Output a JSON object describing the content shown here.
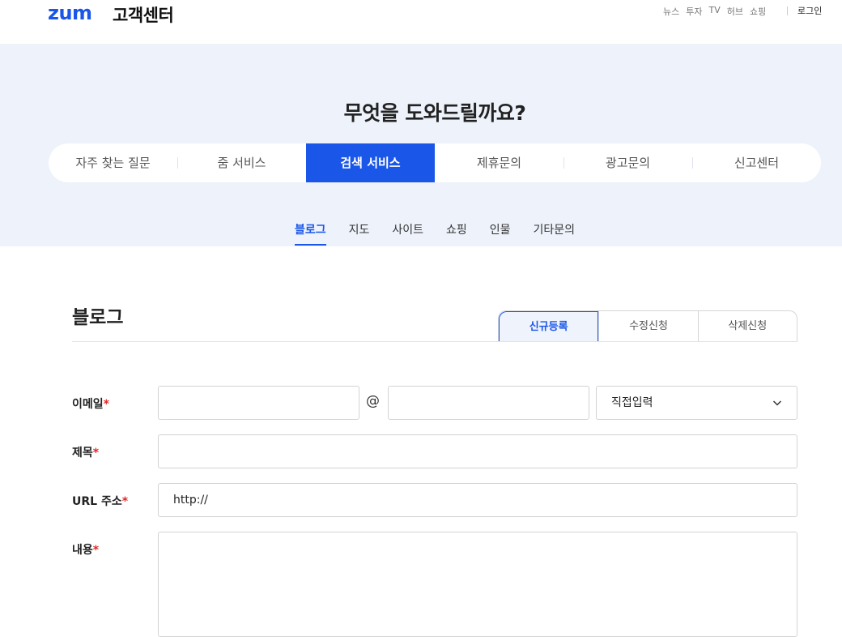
{
  "header": {
    "logo": "zum",
    "site_title": "고객센터",
    "util_links": [
      "뉴스",
      "투자",
      "TV",
      "허브",
      "쇼핑"
    ],
    "login": "로그인"
  },
  "hero": {
    "title": "무엇을 도와드릴까요?",
    "categories": [
      "자주 찾는 질문",
      "줌 서비스",
      "검색 서비스",
      "제휴문의",
      "광고문의",
      "신고센터"
    ],
    "active_category": "검색 서비스",
    "subtabs": [
      "블로그",
      "지도",
      "사이트",
      "쇼핑",
      "인물",
      "기타문의"
    ],
    "active_subtab": "블로그"
  },
  "section": {
    "title": "블로그",
    "request_tabs": [
      "신규등록",
      "수정신청",
      "삭제신청"
    ],
    "active_request_tab": "신규등록"
  },
  "form": {
    "email_label": "이메일",
    "email_at": "@",
    "email_domain_select": "직접입력",
    "title_label": "제목",
    "url_label": "URL 주소",
    "url_value": "http://",
    "content_label": "내용",
    "required_mark": "*"
  },
  "colors": {
    "accent": "#1a56e8",
    "hero_bg": "#edf2fb",
    "required": "#e12626"
  }
}
